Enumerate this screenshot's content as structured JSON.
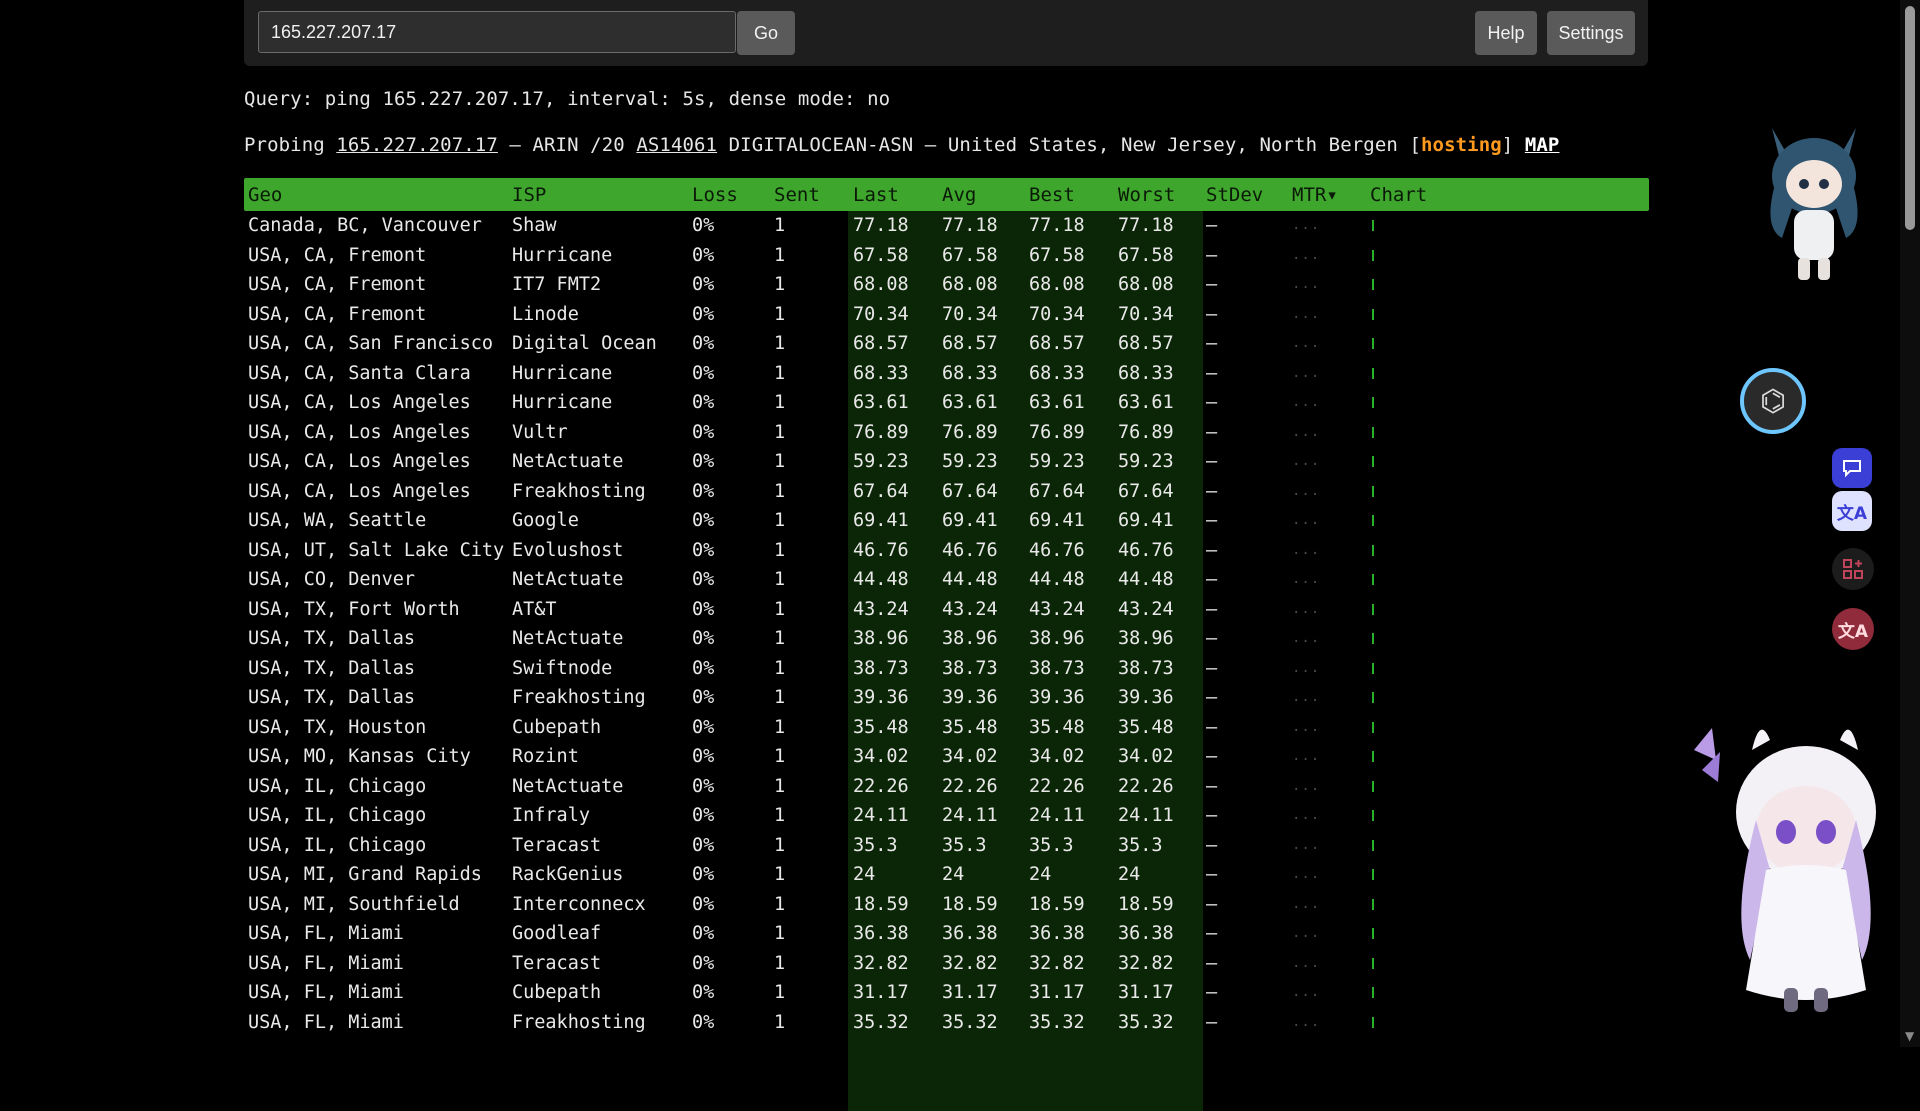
{
  "toolbar": {
    "query_value": "165.227.207.17",
    "go_label": "Go",
    "help_label": "Help",
    "settings_label": "Settings"
  },
  "query_line": "Query: ping 165.227.207.17, interval: 5s, dense mode: no",
  "probe": {
    "prefix": "Probing ",
    "ip": "165.227.207.17",
    "mid": " — ARIN /20 ",
    "asn": "AS14061",
    "rest": " DIGITALOCEAN-ASN — United States, New Jersey, North Bergen [",
    "tag": "hosting",
    "close": "] ",
    "map": "MAP"
  },
  "table": {
    "headers": [
      "Geo",
      "ISP",
      "Loss",
      "Sent",
      "Last",
      "Avg",
      "Best",
      "Worst",
      "StDev",
      "MTR▾",
      "Chart"
    ],
    "rows": [
      [
        "Canada, BC, Vancouver",
        "Shaw",
        "0%",
        "1",
        "77.18",
        "77.18",
        "77.18",
        "77.18",
        "—",
        "..."
      ],
      [
        "USA, CA, Fremont",
        "Hurricane",
        "0%",
        "1",
        "67.58",
        "67.58",
        "67.58",
        "67.58",
        "—",
        "..."
      ],
      [
        "USA, CA, Fremont",
        "IT7 FMT2",
        "0%",
        "1",
        "68.08",
        "68.08",
        "68.08",
        "68.08",
        "—",
        "..."
      ],
      [
        "USA, CA, Fremont",
        "Linode",
        "0%",
        "1",
        "70.34",
        "70.34",
        "70.34",
        "70.34",
        "—",
        "..."
      ],
      [
        "USA, CA, San Francisco",
        "Digital Ocean",
        "0%",
        "1",
        "68.57",
        "68.57",
        "68.57",
        "68.57",
        "—",
        "..."
      ],
      [
        "USA, CA, Santa Clara",
        "Hurricane",
        "0%",
        "1",
        "68.33",
        "68.33",
        "68.33",
        "68.33",
        "—",
        "..."
      ],
      [
        "USA, CA, Los Angeles",
        "Hurricane",
        "0%",
        "1",
        "63.61",
        "63.61",
        "63.61",
        "63.61",
        "—",
        "..."
      ],
      [
        "USA, CA, Los Angeles",
        "Vultr",
        "0%",
        "1",
        "76.89",
        "76.89",
        "76.89",
        "76.89",
        "—",
        "..."
      ],
      [
        "USA, CA, Los Angeles",
        "NetActuate",
        "0%",
        "1",
        "59.23",
        "59.23",
        "59.23",
        "59.23",
        "—",
        "..."
      ],
      [
        "USA, CA, Los Angeles",
        "Freakhosting",
        "0%",
        "1",
        "67.64",
        "67.64",
        "67.64",
        "67.64",
        "—",
        "..."
      ],
      [
        "USA, WA, Seattle",
        "Google",
        "0%",
        "1",
        "69.41",
        "69.41",
        "69.41",
        "69.41",
        "—",
        "..."
      ],
      [
        "USA, UT, Salt Lake City",
        "Evolushost",
        "0%",
        "1",
        "46.76",
        "46.76",
        "46.76",
        "46.76",
        "—",
        "..."
      ],
      [
        "USA, CO, Denver",
        "NetActuate",
        "0%",
        "1",
        "44.48",
        "44.48",
        "44.48",
        "44.48",
        "—",
        "..."
      ],
      [
        "USA, TX, Fort Worth",
        "AT&T",
        "0%",
        "1",
        "43.24",
        "43.24",
        "43.24",
        "43.24",
        "—",
        "..."
      ],
      [
        "USA, TX, Dallas",
        "NetActuate",
        "0%",
        "1",
        "38.96",
        "38.96",
        "38.96",
        "38.96",
        "—",
        "..."
      ],
      [
        "USA, TX, Dallas",
        "Swiftnode",
        "0%",
        "1",
        "38.73",
        "38.73",
        "38.73",
        "38.73",
        "—",
        "..."
      ],
      [
        "USA, TX, Dallas",
        "Freakhosting",
        "0%",
        "1",
        "39.36",
        "39.36",
        "39.36",
        "39.36",
        "—",
        "..."
      ],
      [
        "USA, TX, Houston",
        "Cubepath",
        "0%",
        "1",
        "35.48",
        "35.48",
        "35.48",
        "35.48",
        "—",
        "..."
      ],
      [
        "USA, MO, Kansas City",
        "Rozint",
        "0%",
        "1",
        "34.02",
        "34.02",
        "34.02",
        "34.02",
        "—",
        "..."
      ],
      [
        "USA, IL, Chicago",
        "NetActuate",
        "0%",
        "1",
        "22.26",
        "22.26",
        "22.26",
        "22.26",
        "—",
        "..."
      ],
      [
        "USA, IL, Chicago",
        "Infraly",
        "0%",
        "1",
        "24.11",
        "24.11",
        "24.11",
        "24.11",
        "—",
        "..."
      ],
      [
        "USA, IL, Chicago",
        "Teracast",
        "0%",
        "1",
        "35.3",
        "35.3",
        "35.3",
        "35.3",
        "—",
        "..."
      ],
      [
        "USA, MI, Grand Rapids",
        "RackGenius",
        "0%",
        "1",
        "24",
        "24",
        "24",
        "24",
        "—",
        "..."
      ],
      [
        "USA, MI, Southfield",
        "Interconnecx",
        "0%",
        "1",
        "18.59",
        "18.59",
        "18.59",
        "18.59",
        "—",
        "..."
      ],
      [
        "USA, FL, Miami",
        "Goodleaf",
        "0%",
        "1",
        "36.38",
        "36.38",
        "36.38",
        "36.38",
        "—",
        "..."
      ],
      [
        "USA, FL, Miami",
        "Teracast",
        "0%",
        "1",
        "32.82",
        "32.82",
        "32.82",
        "32.82",
        "—",
        "..."
      ],
      [
        "USA, FL, Miami",
        "Cubepath",
        "0%",
        "1",
        "31.17",
        "31.17",
        "31.17",
        "31.17",
        "—",
        "..."
      ],
      [
        "USA, FL, Miami",
        "Freakhosting",
        "0%",
        "1",
        "35.32",
        "35.32",
        "35.32",
        "35.32",
        "—",
        "..."
      ]
    ]
  },
  "colors": {
    "header_bg": "#3ea62c",
    "stat_band": "#0b2606",
    "hosting_tag": "#ff9a1f",
    "chart_tick": "#27b22a"
  },
  "icons": {
    "ai_assistant": "ai-assistant-icon",
    "chat": "chat-icon",
    "translate": "translate-icon",
    "apps": "apps-icon",
    "translate_alt": "translate-alt-icon"
  },
  "widgets": {
    "translate_glyph": "文A",
    "translate_alt_glyph": "文A"
  }
}
